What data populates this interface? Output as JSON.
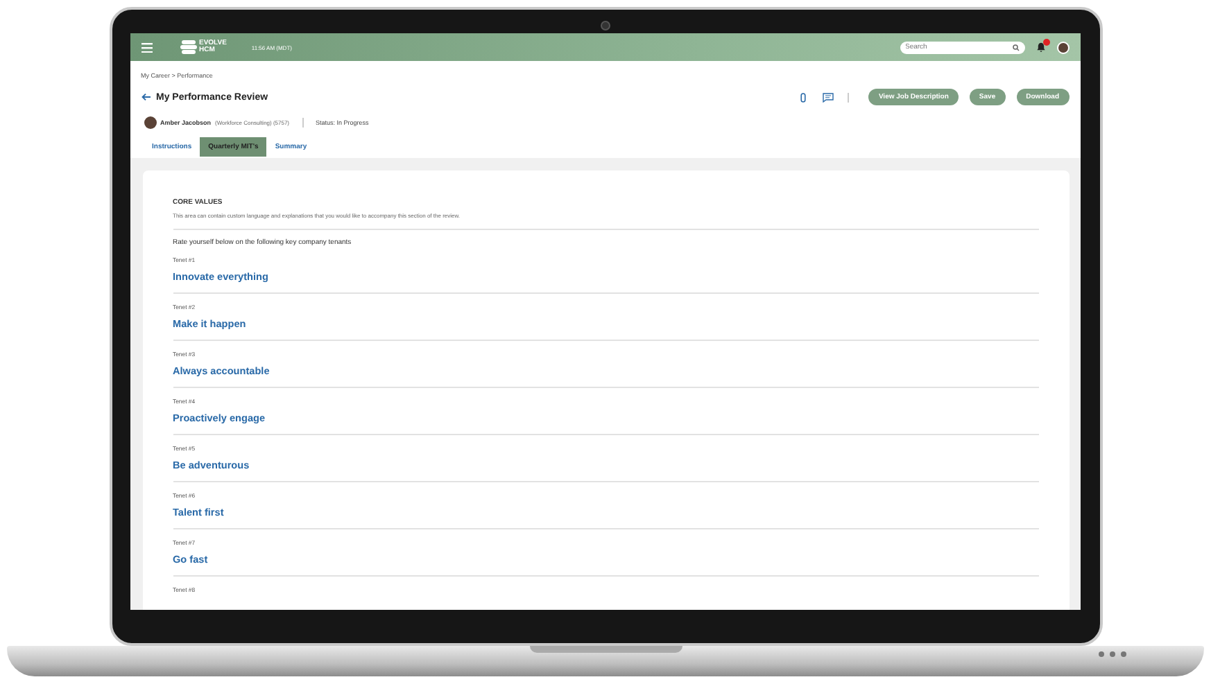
{
  "header": {
    "logo_text": [
      "EVOLVE",
      "HCM"
    ],
    "time": "11:56 AM (MDT)",
    "search": {
      "placeholder": "Search"
    },
    "has_notifications": true
  },
  "breadcrumb": "My Career > Performance",
  "page": {
    "title": "My Performance Review",
    "buttons": [
      "View Job Description",
      "Save",
      "Download"
    ]
  },
  "employee": {
    "name": "Amber Jacobson",
    "detail": "(Workforce Consulting) (5757)",
    "status": "Status: In Progress"
  },
  "tabs": [
    {
      "label": "Instructions",
      "selected": false
    },
    {
      "label": "Quarterly MIT's",
      "selected": true
    },
    {
      "label": "Summary",
      "selected": false
    }
  ],
  "section": {
    "heading": "CORE VALUES",
    "description": "This area can contain custom language and explanations that you would like to accompany this section of the review.",
    "prompt": "Rate yourself below on the following key company tenants",
    "tenets": [
      {
        "label": "Tenet #1",
        "title": "Innovate everything"
      },
      {
        "label": "Tenet #2",
        "title": "Make it happen"
      },
      {
        "label": "Tenet #3",
        "title": "Always accountable"
      },
      {
        "label": "Tenet #4",
        "title": "Proactively engage"
      },
      {
        "label": "Tenet #5",
        "title": "Be adventurous"
      },
      {
        "label": "Tenet #6",
        "title": "Talent first"
      },
      {
        "label": "Tenet #7",
        "title": "Go fast"
      },
      {
        "label": "Tenet #8"
      }
    ]
  }
}
